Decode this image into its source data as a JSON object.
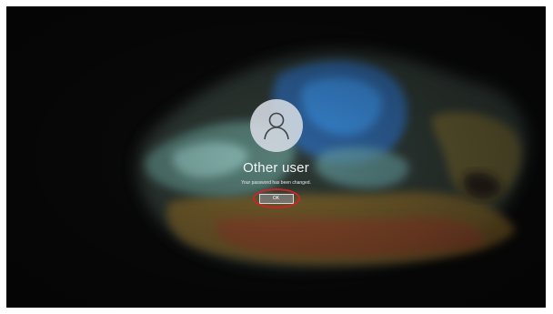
{
  "lock_screen": {
    "avatar_icon": "user-silhouette-icon",
    "username": "Other user",
    "message": "Your password has been changed.",
    "ok_label": "OK"
  },
  "colors": {
    "highlight_ring": "#c8262b",
    "background": "#0b0b0c"
  }
}
